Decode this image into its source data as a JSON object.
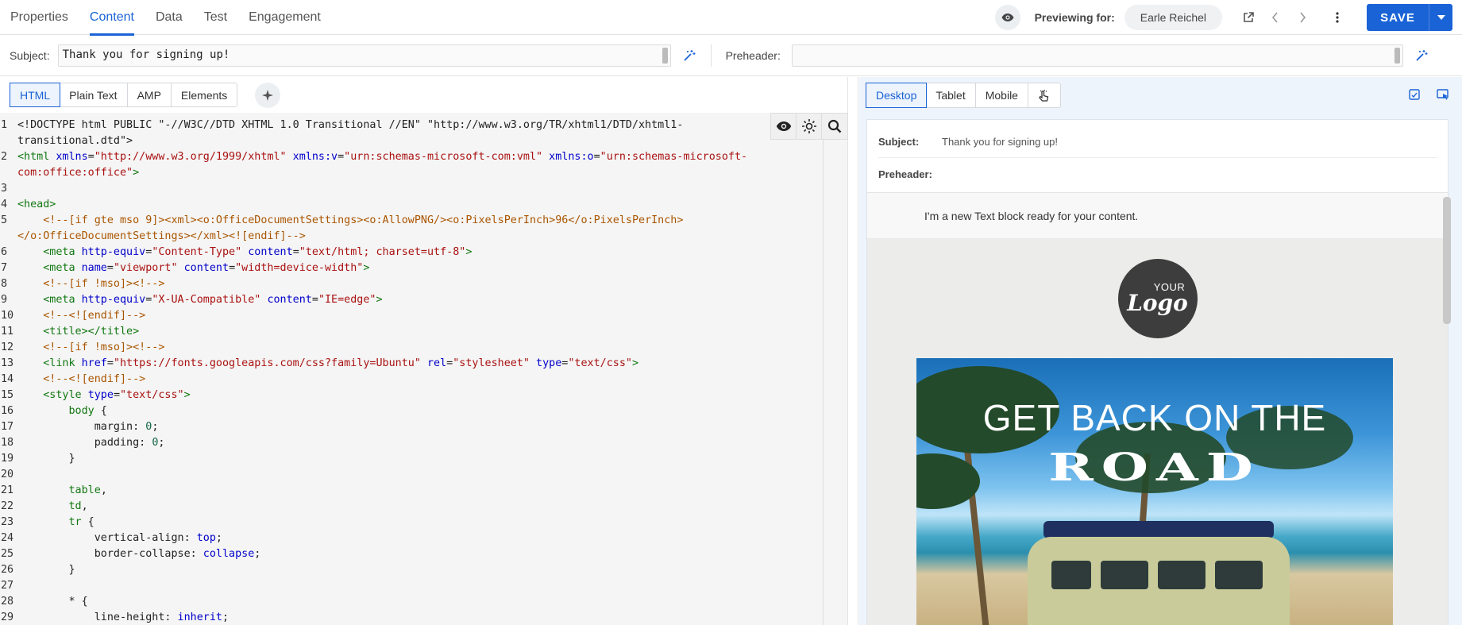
{
  "topbar": {
    "tabs": [
      "Properties",
      "Content",
      "Data",
      "Test",
      "Engagement"
    ],
    "active_tab": "Content",
    "previewing_label": "Previewing for:",
    "previewing_user": "Earle Reichel",
    "save_label": "SAVE"
  },
  "subject_bar": {
    "subject_label": "Subject:",
    "subject_value": "Thank you for signing up!",
    "preheader_label": "Preheader:",
    "preheader_value": ""
  },
  "editor": {
    "modes": [
      "HTML",
      "Plain Text",
      "AMP",
      "Elements"
    ],
    "active_mode": "HTML"
  },
  "code_lines": [
    {
      "n": "1",
      "html": "&lt;!DOCTYPE html PUBLIC \"-//W3C//DTD XHTML 1.0 Transitional //EN\" \"http://www.w3.org/TR/xhtml1/DTD/xhtml1-"
    },
    {
      "n": "",
      "html": "transitional.dtd\"&gt;"
    },
    {
      "n": "2",
      "html": "<span class='t'>&lt;html</span> <span class='a'>xmlns</span>=<span class='s'>\"http://www.w3.org/1999/xhtml\"</span> <span class='a'>xmlns:v</span>=<span class='s'>\"urn:schemas-microsoft-com:vml\"</span> <span class='a'>xmlns:o</span>=<span class='s'>\"urn:schemas-microsoft-</span>"
    },
    {
      "n": "",
      "html": "<span class='s'>com:office:office\"</span><span class='t'>&gt;</span>"
    },
    {
      "n": "3",
      "html": ""
    },
    {
      "n": "4",
      "html": "<span class='t'>&lt;head&gt;</span>"
    },
    {
      "n": "5",
      "html": "    <span class='c'>&lt;!--[if gte mso 9]&gt;&lt;xml&gt;&lt;o:OfficeDocumentSettings&gt;&lt;o:AllowPNG/&gt;&lt;o:PixelsPerInch&gt;96&lt;/o:PixelsPerInch&gt;</span>"
    },
    {
      "n": "",
      "html": "<span class='c'>&lt;/o:OfficeDocumentSettings&gt;&lt;/xml&gt;&lt;![endif]--&gt;</span>"
    },
    {
      "n": "6",
      "html": "    <span class='t'>&lt;meta</span> <span class='a'>http-equiv</span>=<span class='s'>\"Content-Type\"</span> <span class='a'>content</span>=<span class='s'>\"text/html; charset=utf-8\"</span><span class='t'>&gt;</span>"
    },
    {
      "n": "7",
      "html": "    <span class='t'>&lt;meta</span> <span class='a'>name</span>=<span class='s'>\"viewport\"</span> <span class='a'>content</span>=<span class='s'>\"width=device-width\"</span><span class='t'>&gt;</span>"
    },
    {
      "n": "8",
      "html": "    <span class='c'>&lt;!--[if !mso]&gt;&lt;!--&gt;</span>"
    },
    {
      "n": "9",
      "html": "    <span class='t'>&lt;meta</span> <span class='a'>http-equiv</span>=<span class='s'>\"X-UA-Compatible\"</span> <span class='a'>content</span>=<span class='s'>\"IE=edge\"</span><span class='t'>&gt;</span>"
    },
    {
      "n": "10",
      "html": "    <span class='c'>&lt;!--&lt;![endif]--&gt;</span>"
    },
    {
      "n": "11",
      "html": "    <span class='t'>&lt;title&gt;&lt;/title&gt;</span>"
    },
    {
      "n": "12",
      "html": "    <span class='c'>&lt;!--[if !mso]&gt;&lt;!--&gt;</span>"
    },
    {
      "n": "13",
      "html": "    <span class='t'>&lt;link</span> <span class='a'>href</span>=<span class='s'>\"https://fonts.googleapis.com/css?family=Ubuntu\"</span> <span class='a'>rel</span>=<span class='s'>\"stylesheet\"</span> <span class='a'>type</span>=<span class='s'>\"text/css\"</span><span class='t'>&gt;</span>"
    },
    {
      "n": "14",
      "html": "    <span class='c'>&lt;!--&lt;![endif]--&gt;</span>"
    },
    {
      "n": "15",
      "html": "    <span class='t'>&lt;style</span> <span class='a'>type</span>=<span class='s'>\"text/css\"</span><span class='t'>&gt;</span>"
    },
    {
      "n": "16",
      "html": "        <span class='t'>body</span> {"
    },
    {
      "n": "17",
      "html": "            margin: <span class='n'>0</span>;"
    },
    {
      "n": "18",
      "html": "            padding: <span class='n'>0</span>;"
    },
    {
      "n": "19",
      "html": "        }"
    },
    {
      "n": "20",
      "html": ""
    },
    {
      "n": "21",
      "html": "        <span class='t'>table</span>,"
    },
    {
      "n": "22",
      "html": "        <span class='t'>td</span>,"
    },
    {
      "n": "23",
      "html": "        <span class='t'>tr</span> {"
    },
    {
      "n": "24",
      "html": "            vertical-align: <span class='a'>top</span>;"
    },
    {
      "n": "25",
      "html": "            border-collapse: <span class='a'>collapse</span>;"
    },
    {
      "n": "26",
      "html": "        }"
    },
    {
      "n": "27",
      "html": ""
    },
    {
      "n": "28",
      "html": "        * {"
    },
    {
      "n": "29",
      "html": "            line-height: <span class='a'>inherit</span>;"
    }
  ],
  "preview": {
    "devices": [
      "Desktop",
      "Tablet",
      "Mobile"
    ],
    "active_device": "Desktop",
    "subject_label": "Subject:",
    "subject_value": "Thank you for signing up!",
    "preheader_label": "Preheader:",
    "preheader_value": "",
    "text_block": "I'm a new Text block ready for your content.",
    "logo_small": "YOUR",
    "logo_large": "Logo",
    "hero_line1": "GET BACK ON THE",
    "hero_line2": "ROAD"
  },
  "colors": {
    "accent": "#1a63d6"
  },
  "icons": {
    "eye": "eye-icon",
    "external": "external-link-icon",
    "prev": "chevron-left-icon",
    "next": "chevron-right-icon",
    "more": "more-vertical-icon",
    "dropdown": "caret-down-icon",
    "wand": "magic-wand-icon",
    "sparkle": "sparkle-icon",
    "brightness": "brightness-icon",
    "search": "search-icon",
    "pointer": "pointer-icon"
  }
}
